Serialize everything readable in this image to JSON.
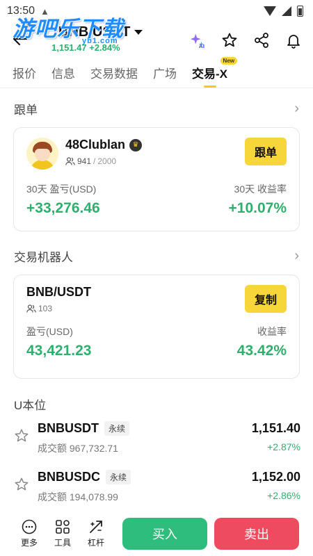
{
  "status_bar": {
    "time": "13:50"
  },
  "watermark": {
    "text": "游吧乐下载",
    "sub": "yb1.com"
  },
  "header": {
    "pair": "BNB/USDT",
    "price": "1,151.47",
    "change": "+2.84%"
  },
  "tabs": [
    {
      "label": "报价"
    },
    {
      "label": "信息"
    },
    {
      "label": "交易数据"
    },
    {
      "label": "广场"
    },
    {
      "label": "交易-X",
      "badge": "New",
      "active": true
    }
  ],
  "copy_trading": {
    "section_title": "跟单",
    "trader_name": "48Clublan",
    "followers": "941",
    "followers_max": "2000",
    "button_label": "跟单",
    "pnl_label": "30天 盈亏(USD)",
    "pnl_value": "+33,276.46",
    "roi_label": "30天 收益率",
    "roi_value": "+10.07%"
  },
  "trading_bot": {
    "section_title": "交易机器人",
    "pair": "BNB/USDT",
    "users": "103",
    "button_label": "复制",
    "pnl_label": "盈亏(USD)",
    "pnl_value": "43,421.23",
    "roi_label": "收益率",
    "roi_value": "43.42%"
  },
  "u_margin": {
    "section_title": "U本位",
    "rows": [
      {
        "symbol": "BNBUSDT",
        "tag": "永续",
        "volume": "成交额 967,732.71",
        "price": "1,151.40",
        "change": "+2.87%"
      },
      {
        "symbol": "BNBUSDC",
        "tag": "永续",
        "volume": "成交额 194,078.99",
        "price": "1,152.00",
        "change": "+2.86%"
      }
    ]
  },
  "bottom_bar": {
    "more": "更多",
    "tools": "工具",
    "leverage": "杠杆",
    "buy": "买入",
    "sell": "卖出"
  },
  "colors": {
    "positive": "#2eaf6e",
    "accent_yellow": "#f7d63a",
    "buy": "#2fbd7e",
    "sell": "#ee4b61"
  }
}
